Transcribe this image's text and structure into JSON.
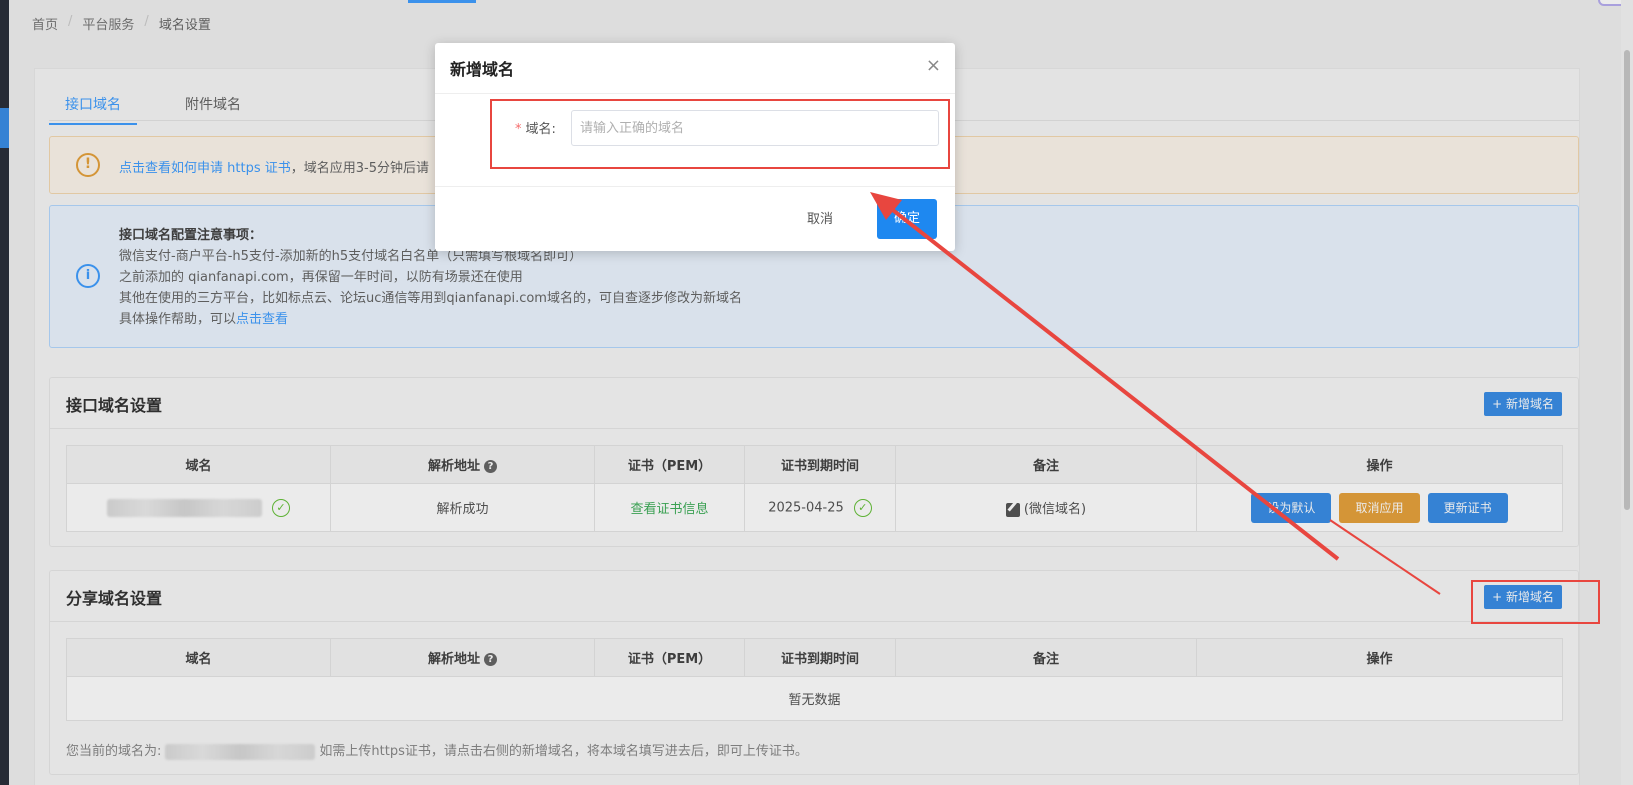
{
  "breadcrumb": [
    "首页",
    "平台服务",
    "域名设置"
  ],
  "tabs": [
    {
      "label": "接口域名",
      "active": true
    },
    {
      "label": "附件域名",
      "active": false
    }
  ],
  "alert_warning": {
    "link_text": "点击查看如何申请 https 证书",
    "text": "，域名应用3-5分钟后请"
  },
  "alert_info": {
    "title": "接口域名配置注意事项：",
    "line1": "微信支付-商户平台-h5支付-添加新的h5支付域名白名单（只需填写根域名即可）",
    "line2": "之前添加的 qianfanapi.com，再保留一年时间，以防有场景还在使用",
    "line3": "其他在使用的三方平台，比如标点云、论坛uc通信等用到qianfanapi.com域名的，可自查逐步修改为新域名",
    "line4_prefix": "具体操作帮助，可以",
    "line4_link": "点击查看"
  },
  "interface_section": {
    "title": "接口域名设置",
    "add_button": "+ 新增域名",
    "columns": [
      "域名",
      "解析地址",
      "证书（PEM）",
      "证书到期时间",
      "备注",
      "操作"
    ],
    "row": {
      "resolve_status": "解析成功",
      "cert_link": "查看证书信息",
      "expiry": "2025-04-25",
      "remark": "(微信域名)",
      "actions": [
        "设为默认",
        "取消应用",
        "更新证书"
      ]
    }
  },
  "share_section": {
    "title": "分享域名设置",
    "add_button": "+ 新增域名",
    "columns": [
      "域名",
      "解析地址",
      "证书（PEM）",
      "证书到期时间",
      "备注",
      "操作"
    ],
    "empty_text": "暂无数据"
  },
  "footnote": {
    "prefix": "您当前的域名为:",
    "suffix": "如需上传https证书，请点击右侧的新增域名，将本域名填写进去后，即可上传证书。"
  },
  "dialog": {
    "title": "新增域名",
    "close": "×",
    "field_label": "域名:",
    "required_mark": "*",
    "input_placeholder": "请输入正确的域名",
    "input_value": "",
    "cancel": "取消",
    "confirm": "确定"
  },
  "colors": {
    "primary": "#409eff",
    "warning": "#e6a23c",
    "annotation_red": "#e8463f"
  }
}
